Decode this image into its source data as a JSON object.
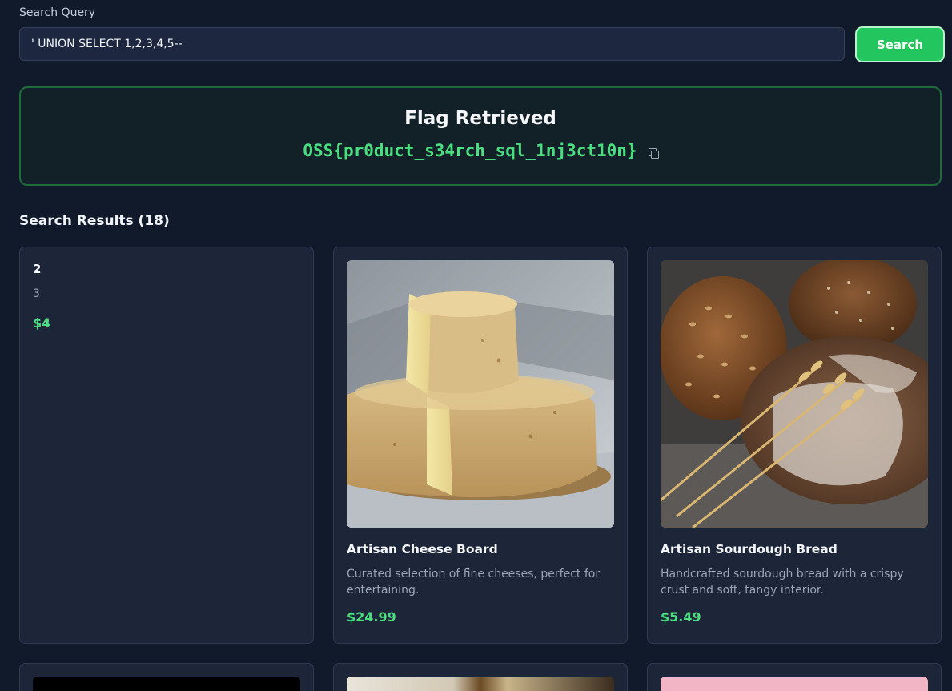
{
  "search": {
    "label": "Search Query",
    "value": "' UNION SELECT 1,2,3,4,5--",
    "button_label": "Search"
  },
  "flag": {
    "title": "Flag Retrieved",
    "value": "OSS{pr0duct_s34rch_sql_1nj3ct10n}"
  },
  "results": {
    "heading": "Search Results (18)",
    "injected": {
      "name": "2",
      "description": "3",
      "price": "$4"
    },
    "products": [
      {
        "name": "Artisan Cheese Board",
        "description": "Curated selection of fine cheeses, perfect for entertaining.",
        "price": "$24.99"
      },
      {
        "name": "Artisan Sourdough Bread",
        "description": "Handcrafted sourdough bread with a crispy crust and soft, tangy interior.",
        "price": "$5.49"
      }
    ]
  },
  "colors": {
    "background": "#111a2b",
    "card": "#1c2638",
    "accent_green": "#22c55e",
    "price_green": "#4ade80"
  }
}
